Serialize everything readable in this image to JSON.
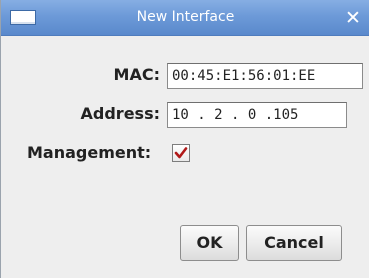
{
  "window": {
    "title": "New Interface",
    "close_glyph": "✕",
    "sysmenu_icon": "window-menu-icon",
    "close_icon": "close-icon",
    "titlebar_color": "#6d9ad8"
  },
  "form": {
    "mac_label": "MAC:",
    "mac_value": "00:45:E1:56:01:EE",
    "address_label": "Address:",
    "address_value": "10 . 2 . 0 .105",
    "management_label": "Management:",
    "management_checked": true,
    "checkmark_color": "#b01818"
  },
  "buttons": {
    "ok_label": "OK",
    "cancel_label": "Cancel"
  }
}
